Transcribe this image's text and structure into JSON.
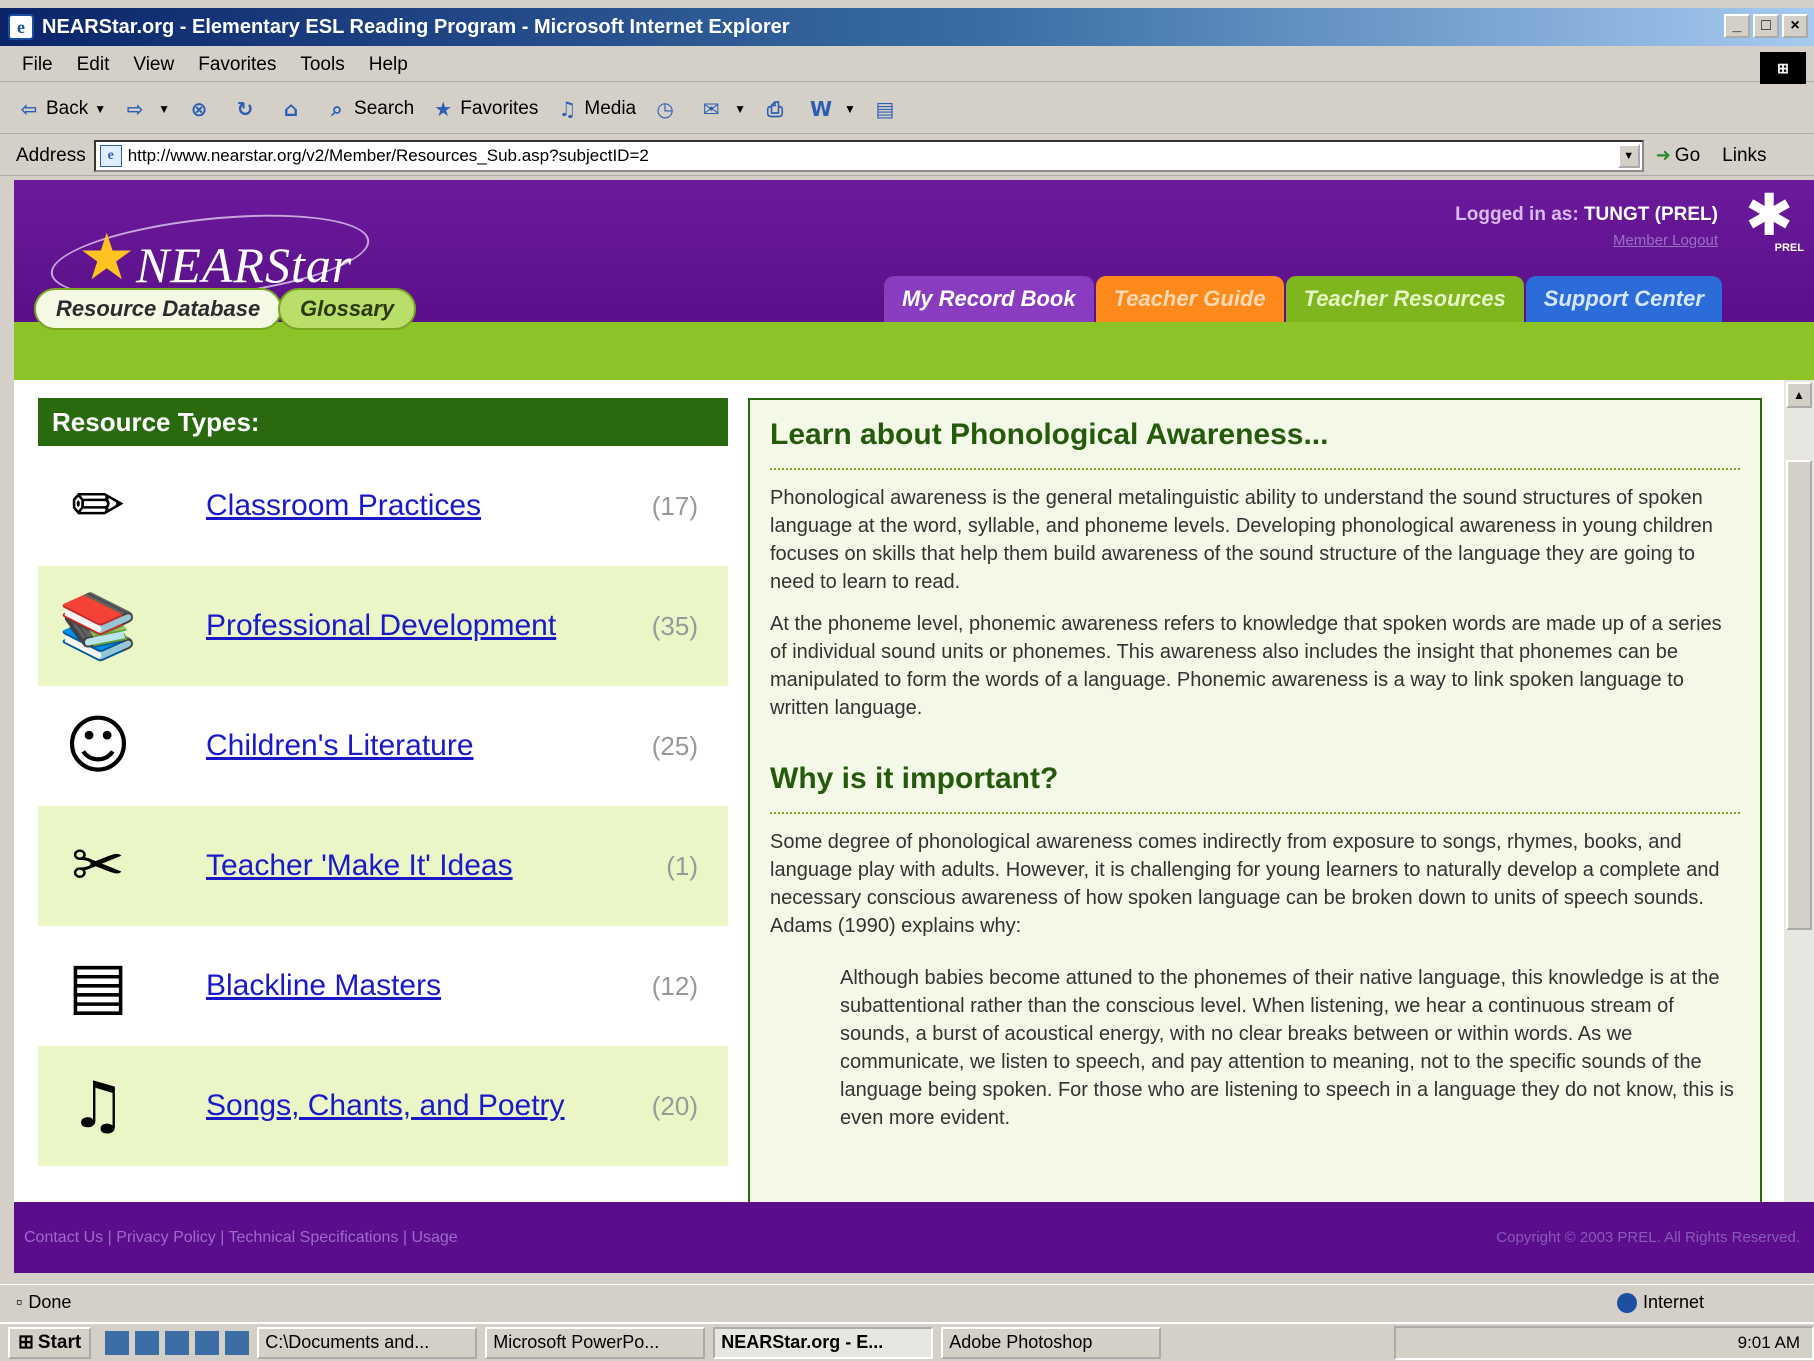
{
  "window": {
    "title": "NEARStar.org - Elementary ESL Reading Program - Microsoft Internet Explorer",
    "buttons": [
      "_",
      "□",
      "×"
    ]
  },
  "menu": [
    "File",
    "Edit",
    "View",
    "Favorites",
    "Tools",
    "Help"
  ],
  "toolbar": {
    "back": "Back",
    "search": "Search",
    "favorites": "Favorites",
    "media": "Media"
  },
  "address": {
    "label": "Address",
    "url": "http://www.nearstar.org/v2/Member/Resources_Sub.asp?subjectID=2",
    "go": "Go",
    "links": "Links"
  },
  "site": {
    "logo_text": "NEARStar",
    "logged_in_label": "Logged in as:",
    "logged_in_user": "TUNGT (PREL)",
    "logout": "Member Logout",
    "prel": "PREL",
    "tabs": [
      "My Record Book",
      "Teacher Guide",
      "Teacher Resources",
      "Support Center"
    ],
    "subnav": [
      "Resource Database",
      "Glossary"
    ]
  },
  "resources": {
    "heading": "Resource Types:",
    "items": [
      {
        "label": "Classroom Practices",
        "count": "(17)",
        "icon": "pencil-cup-icon"
      },
      {
        "label": "Professional Development",
        "count": "(35)",
        "icon": "books-icon"
      },
      {
        "label": "Children's Literature",
        "count": "(25)",
        "icon": "reading-children-icon"
      },
      {
        "label": "Teacher 'Make It' Ideas",
        "count": "(1)",
        "icon": "scissors-icon"
      },
      {
        "label": "Blackline Masters",
        "count": "(12)",
        "icon": "papers-icon"
      },
      {
        "label": "Songs, Chants, and Poetry",
        "count": "(20)",
        "icon": "music-notes-icon"
      }
    ]
  },
  "content": {
    "title": "Learn about Phonological Awareness...",
    "p1": "Phonological awareness is the general metalinguistic ability to understand the sound structures of spoken language at the word, syllable, and phoneme levels. Developing phonological awareness in young children focuses on skills that help them build awareness of the sound structure of the language they are going to need to learn to read.",
    "p2": "At the phoneme level, phonemic awareness refers to knowledge that spoken words are made up of a series of individual sound units or phonemes. This awareness also includes the insight that phonemes can be manipulated to form the words of a language. Phonemic awareness is a way to link spoken language to written language.",
    "title2": "Why is it important?",
    "p3": "Some degree of phonological awareness comes indirectly from exposure to songs, rhymes, books, and language play with adults. However, it is challenging for young learners to naturally develop a complete and necessary conscious awareness of how spoken language can be broken down to units of speech sounds. Adams (1990) explains why:",
    "quote": "Although babies become attuned to the phonemes of their native language, this knowledge is at the subattentional rather than the conscious level. When listening, we hear a continuous stream of sounds, a burst of acoustical energy, with no clear breaks between or within words. As we communicate, we listen to speech, and pay attention to meaning, not to the specific sounds of the language being spoken. For those who are listening to speech in a language they do not know, this is even more evident."
  },
  "footer": {
    "links": "Contact Us  |  Privacy Policy  |  Technical Specifications  |  Usage",
    "copyright": "Copyright © 2003 PREL. All Rights Reserved."
  },
  "status": {
    "text": "Done",
    "zone": "Internet"
  },
  "taskbar": {
    "start": "Start",
    "tasks": [
      "C:\\Documents and...",
      "Microsoft PowerPo...",
      "NEARStar.org - E...",
      "Adobe Photoshop"
    ],
    "clock": "9:01 AM"
  },
  "colors": {
    "header_purple": "#6b1a9c",
    "nav_green": "#8cc327",
    "heading_green": "#2a6a0e",
    "link_blue": "#1a1ac8"
  }
}
